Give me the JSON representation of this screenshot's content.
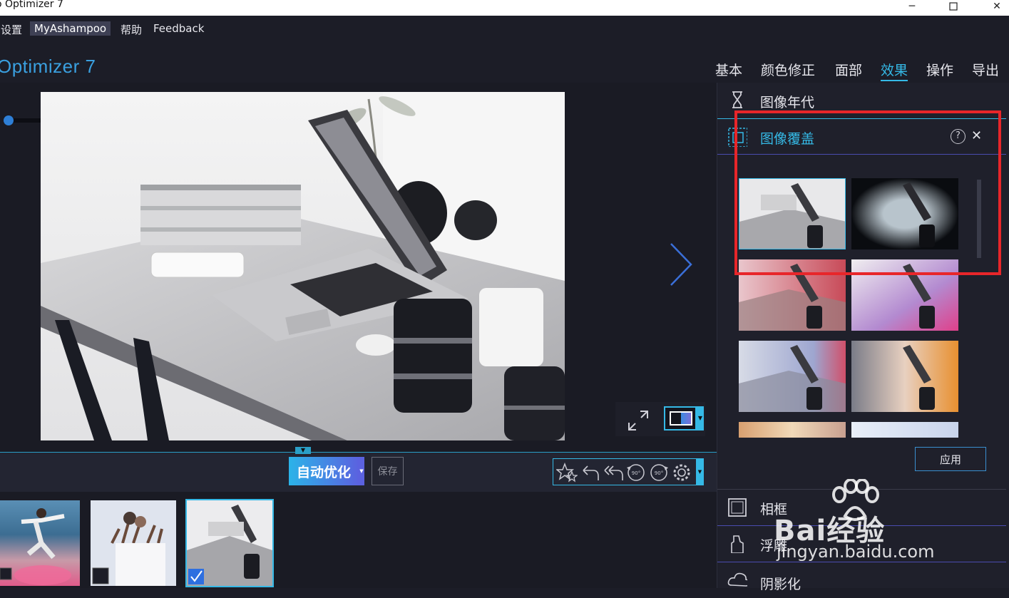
{
  "window": {
    "title": "o Optimizer 7"
  },
  "menu": {
    "items": [
      "设置",
      "MyAshampoo",
      "帮助",
      "Feedback"
    ]
  },
  "header": {
    "app_title": "Optimizer 7",
    "tabs": [
      {
        "label": "基本"
      },
      {
        "label": "颜色修正"
      },
      {
        "label": "面部"
      },
      {
        "label": "效果",
        "active": true
      },
      {
        "label": "操作"
      },
      {
        "label": "导出"
      }
    ]
  },
  "toolbar": {
    "auto_optimize": "自动优化",
    "save": "保存",
    "rotate_left_label": "90°",
    "rotate_right_label": "90°"
  },
  "panel": {
    "image_age": "图像年代",
    "image_overlay": "图像覆盖",
    "help": "?",
    "close": "✕",
    "apply": "应用",
    "frame": "相框",
    "emboss": "浮雕",
    "shadow": "阴影化"
  },
  "watermark": {
    "brand": "Bai经验",
    "url": "jingyan.baidu.com"
  },
  "colors": {
    "accent": "#35b9e6",
    "highlight": "#e8262a",
    "background": "#1c1d27",
    "panel": "#1f202b"
  },
  "icons": [
    "minimize-icon",
    "maximize-icon",
    "close-icon",
    "hourglass-icon",
    "overlay-icon",
    "frame-icon",
    "emboss-icon",
    "cloud-icon",
    "star-icon",
    "undo-icon",
    "undo-all-icon",
    "rotate-left-icon",
    "rotate-right-icon",
    "gear-icon",
    "expand-icon",
    "compare-icon",
    "chevron-right-icon",
    "checkmark-icon"
  ]
}
